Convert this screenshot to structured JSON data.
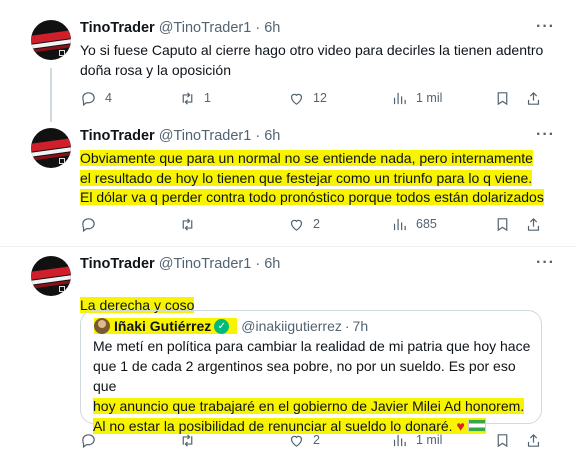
{
  "tweets": [
    {
      "name": "TinoTrader",
      "handle": "@TinoTrader1",
      "time": "6h",
      "text": "Yo si fuese Caputo al cierre hago otro video para decirles la tienen adentro doña rosa y la oposición",
      "replies": "4",
      "retweets": "1",
      "likes": "12",
      "views": "1 mil"
    },
    {
      "name": "TinoTrader",
      "handle": "@TinoTrader1",
      "time": "6h",
      "lines": [
        "Obviamente que para un normal no se entiende nada, pero internamente",
        "el resultado de hoy lo tienen que festejar como un triunfo para lo q viene.",
        "El dólar va q perder contra todo pronóstico porque todos están dolarizados"
      ],
      "replies": "",
      "retweets": "",
      "likes": "2",
      "views": "685"
    },
    {
      "name": "TinoTrader",
      "handle": "@TinoTrader1",
      "time": "6h",
      "text": "La derecha y coso",
      "replies": "",
      "retweets": "",
      "likes": "2",
      "views": "1 mil"
    }
  ],
  "quote": {
    "name": "Iñaki Gutiérrez",
    "handle": "@inakiigutierrez",
    "time": "7h",
    "lines": [
      "Me metí en política para cambiar la realidad de mi patria que hoy hace",
      "que 1 de cada 2 argentinos sea pobre, no por un sueldo. Es por eso que",
      "hoy anuncio que trabajaré en el gobierno de Javier Milei Ad honorem.",
      "Al no estar la posibilidad de renunciar al sueldo lo donaré."
    ]
  },
  "common": {
    "dot": "·",
    "more": "···"
  },
  "colors": {
    "highlight": "#f8f400",
    "verified": "#00ba7c",
    "secondary_text": "#536471",
    "divider": "#eff3f4"
  },
  "icons": [
    "reply-icon",
    "retweet-icon",
    "like-icon",
    "views-icon",
    "bookmark-icon",
    "share-icon",
    "verified-icon",
    "heart-emoji",
    "flag-emoji"
  ]
}
